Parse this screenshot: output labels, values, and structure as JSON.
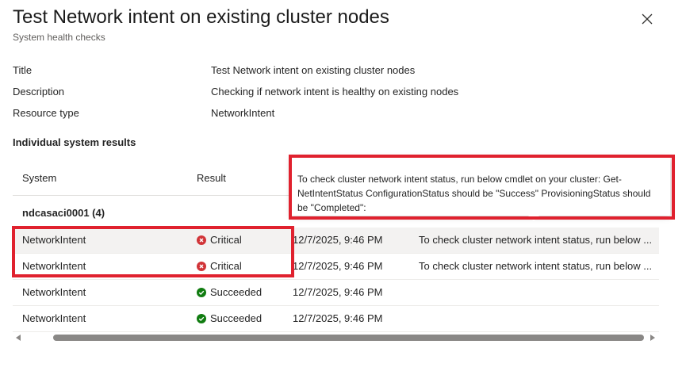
{
  "panel": {
    "title": "Test Network intent on existing cluster nodes",
    "subtitle": "System health checks",
    "close_icon": "close-icon"
  },
  "details": [
    {
      "label": "Title",
      "value": "Test Network intent on existing cluster nodes"
    },
    {
      "label": "Description",
      "value": "Checking if network intent is healthy on existing nodes"
    },
    {
      "label": "Resource type",
      "value": "NetworkIntent"
    }
  ],
  "results": {
    "heading": "Individual system results",
    "columns": {
      "system": "System",
      "result": "Result"
    },
    "group": "ndcasaci0001 (4)",
    "rows": [
      {
        "system": "NetworkIntent",
        "result": "Critical",
        "status_icon": "critical-icon",
        "time": "12/7/2025, 9:46 PM",
        "message": "To check cluster network intent status, run below ..."
      },
      {
        "system": "NetworkIntent",
        "result": "Critical",
        "status_icon": "critical-icon",
        "time": "12/7/2025, 9:46 PM",
        "message": "To check cluster network intent status, run below ..."
      },
      {
        "system": "NetworkIntent",
        "result": "Succeeded",
        "status_icon": "success-icon",
        "time": "12/7/2025, 9:46 PM",
        "message": ""
      },
      {
        "system": "NetworkIntent",
        "result": "Succeeded",
        "status_icon": "success-icon",
        "time": "12/7/2025, 9:46 PM",
        "message": ""
      }
    ]
  },
  "tooltip": {
    "text": "To check cluster network intent status, run below cmdlet on your cluster: Get-NetIntentStatus ConfigurationStatus should be \"Success\" ProvisioningStatus should be \"Completed\":"
  },
  "colors": {
    "critical": "#d13438",
    "success": "#107c10",
    "highlight": "#e0212e"
  }
}
